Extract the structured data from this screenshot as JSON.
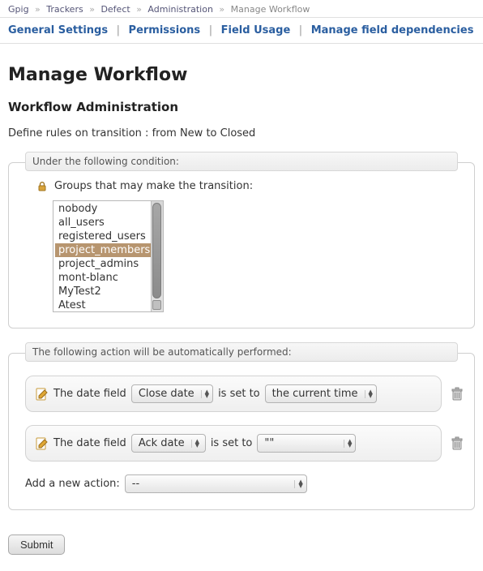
{
  "breadcrumb": {
    "items": [
      "Gpig",
      "Trackers",
      "Defect",
      "Administration"
    ],
    "current": "Manage Workflow"
  },
  "tabs": {
    "items": [
      "General Settings",
      "Permissions",
      "Field Usage",
      "Manage field dependencies"
    ]
  },
  "page": {
    "h1": "Manage Workflow",
    "h2": "Workflow Administration",
    "subtitle": "Define rules on transition : from New to Closed"
  },
  "condition": {
    "legend": "Under the following condition:",
    "label": "Groups that may make the transition:",
    "options": [
      "nobody",
      "all_users",
      "registered_users",
      "project_members",
      "project_admins",
      "mont-blanc",
      "MyTest2",
      "Atest"
    ],
    "selected_index": 3
  },
  "actions": {
    "legend": "The following action will be automatically performed:",
    "rows": [
      {
        "prefix": "The date field",
        "field": "Close date",
        "mid": "is set to",
        "value": "the current time"
      },
      {
        "prefix": "The date field",
        "field": "Ack date",
        "mid": "is set to",
        "value": "\"\""
      }
    ],
    "add_label": "Add a new action:",
    "add_value": "--"
  },
  "buttons": {
    "submit": "Submit"
  }
}
